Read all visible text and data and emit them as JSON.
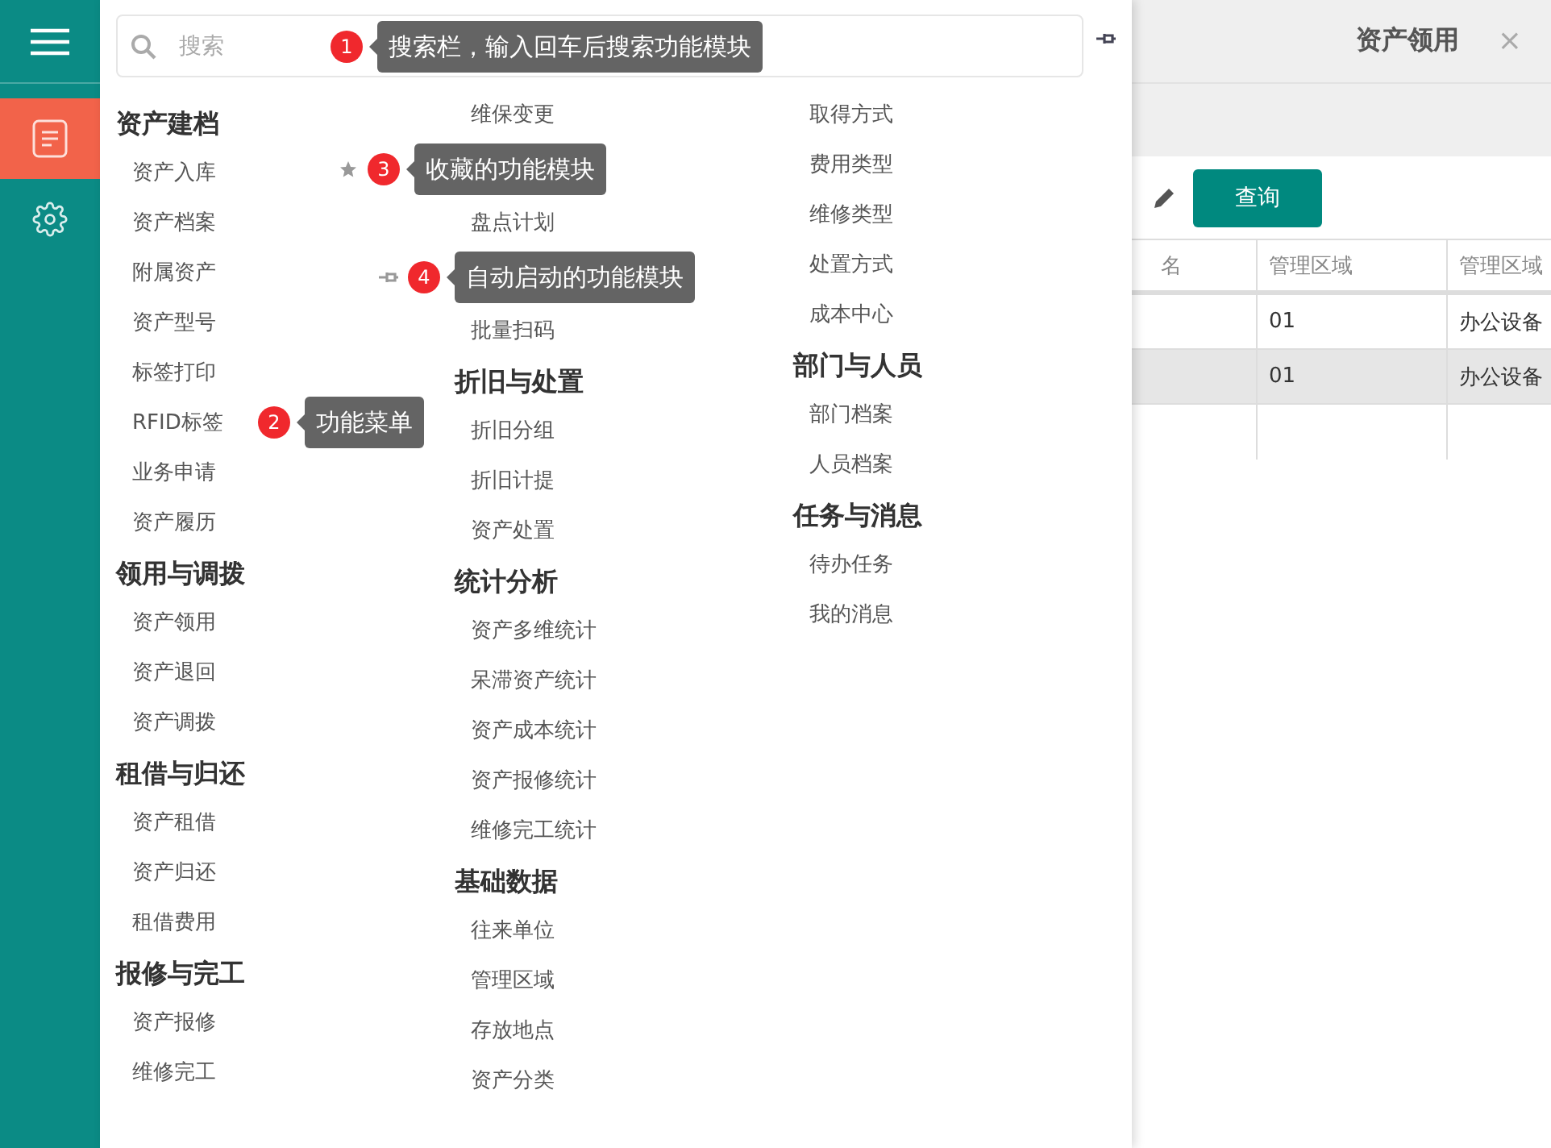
{
  "sidebar": {
    "items": [
      {
        "kind": "document",
        "selected": true
      },
      {
        "kind": "settings",
        "selected": false
      }
    ]
  },
  "search": {
    "placeholder": "搜索",
    "callout": {
      "number": "1",
      "text": "搜索栏，输入回车后搜索功能模块"
    }
  },
  "menu": {
    "callout": {
      "number": "2",
      "text": "功能菜单"
    },
    "columns": [
      {
        "sections": [
          {
            "title": "资产建档",
            "items": [
              {
                "kind": "item",
                "label": "资产入库"
              },
              {
                "kind": "item",
                "label": "资产档案"
              },
              {
                "kind": "item",
                "label": "附属资产"
              },
              {
                "kind": "item",
                "label": "资产型号"
              },
              {
                "kind": "item",
                "label": "标签打印"
              },
              {
                "kind": "item",
                "label": "RFID标签"
              },
              {
                "kind": "item",
                "label": "业务申请"
              },
              {
                "kind": "item",
                "label": "资产履历"
              }
            ]
          },
          {
            "title": "领用与调拨",
            "items": [
              {
                "kind": "item",
                "label": "资产领用"
              },
              {
                "kind": "item",
                "label": "资产退回"
              },
              {
                "kind": "item",
                "label": "资产调拨"
              }
            ]
          },
          {
            "title": "租借与归还",
            "items": [
              {
                "kind": "item",
                "label": "资产租借"
              },
              {
                "kind": "item",
                "label": "资产归还"
              },
              {
                "kind": "item",
                "label": "租借费用"
              }
            ]
          },
          {
            "title": "报修与完工",
            "items": [
              {
                "kind": "item",
                "label": "资产报修"
              },
              {
                "kind": "item",
                "label": "维修完工"
              }
            ]
          }
        ]
      },
      {
        "sections": [
          {
            "items": [
              {
                "kind": "item",
                "label": "维保变更"
              },
              {
                "kind": "starred",
                "number": "3",
                "text": "收藏的功能模块"
              },
              {
                "kind": "item",
                "label": "盘点计划"
              },
              {
                "kind": "pinned",
                "number": "4",
                "text": "自动启动的功能模块"
              },
              {
                "kind": "item",
                "label": "批量扫码"
              }
            ]
          },
          {
            "title": "折旧与处置",
            "items": [
              {
                "kind": "item",
                "label": "折旧分组"
              },
              {
                "kind": "item",
                "label": "折旧计提"
              },
              {
                "kind": "item",
                "label": "资产处置"
              }
            ]
          },
          {
            "title": "统计分析",
            "items": [
              {
                "kind": "item",
                "label": "资产多维统计"
              },
              {
                "kind": "item",
                "label": "呆滞资产统计"
              },
              {
                "kind": "item",
                "label": "资产成本统计"
              },
              {
                "kind": "item",
                "label": "资产报修统计"
              },
              {
                "kind": "item",
                "label": "维修完工统计"
              }
            ]
          },
          {
            "title": "基础数据",
            "items": [
              {
                "kind": "item",
                "label": "往来单位"
              },
              {
                "kind": "item",
                "label": "管理区域"
              },
              {
                "kind": "item",
                "label": "存放地点"
              },
              {
                "kind": "item",
                "label": "资产分类"
              }
            ]
          }
        ]
      },
      {
        "sections": [
          {
            "items": [
              {
                "kind": "item",
                "label": "取得方式"
              },
              {
                "kind": "item",
                "label": "费用类型"
              },
              {
                "kind": "item",
                "label": "维修类型"
              },
              {
                "kind": "item",
                "label": "处置方式"
              },
              {
                "kind": "item",
                "label": "成本中心"
              }
            ]
          },
          {
            "title": "部门与人员",
            "items": [
              {
                "kind": "item",
                "label": "部门档案"
              },
              {
                "kind": "item",
                "label": "人员档案"
              }
            ]
          },
          {
            "title": "任务与消息",
            "items": [
              {
                "kind": "item",
                "label": "待办任务"
              },
              {
                "kind": "item",
                "label": "我的消息"
              }
            ]
          }
        ]
      }
    ]
  },
  "tab": {
    "title": "资产领用",
    "close": "×"
  },
  "toolbar": {
    "button": "查询"
  },
  "table": {
    "columns": [
      "名",
      "管理区域",
      "管理区域"
    ],
    "rows": [
      {
        "cells": [
          "",
          "01",
          "办公设备"
        ],
        "selected": false
      },
      {
        "cells": [
          "",
          "01",
          "办公设备"
        ],
        "selected": true
      }
    ]
  }
}
